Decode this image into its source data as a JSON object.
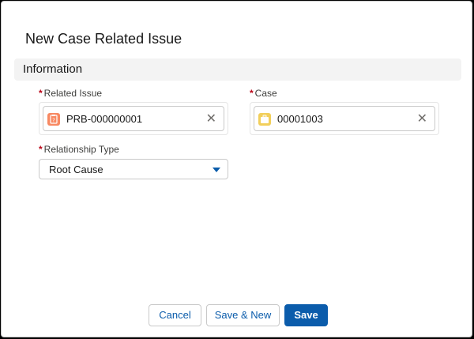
{
  "modal": {
    "title": "New Case Related Issue"
  },
  "section": {
    "title": "Information"
  },
  "fields": {
    "required_marker": "*",
    "related_issue": {
      "label": "Related Issue",
      "value": "PRB-000000001",
      "icon": "problem-icon",
      "icon_color": "#f88962",
      "clear_glyph": "✕"
    },
    "case": {
      "label": "Case",
      "value": "00001003",
      "icon": "case-icon",
      "icon_color": "#f2cf5b",
      "clear_glyph": "✕"
    },
    "relationship_type": {
      "label": "Relationship Type",
      "value": "Root Cause"
    }
  },
  "footer": {
    "cancel_label": "Cancel",
    "save_new_label": "Save & New",
    "save_label": "Save"
  },
  "colors": {
    "brand": "#0b5cab",
    "required": "#ba0517"
  }
}
